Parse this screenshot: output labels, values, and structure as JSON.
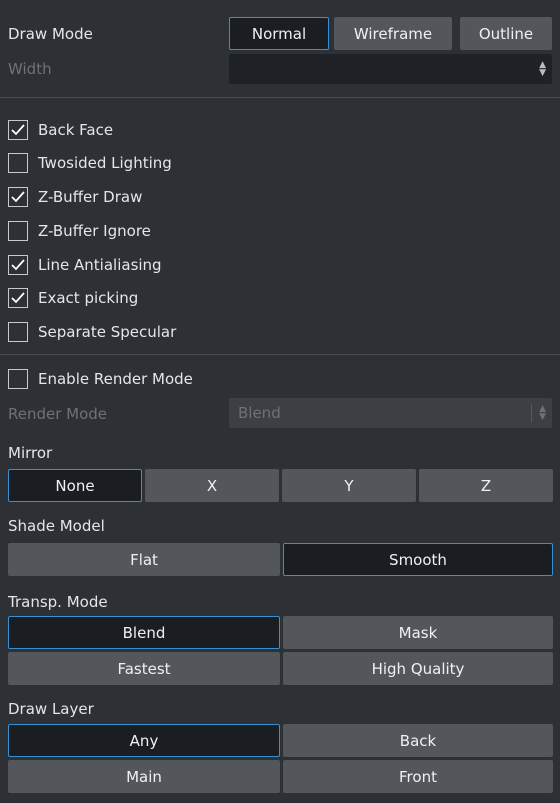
{
  "draw_mode": {
    "label": "Draw Mode",
    "options": [
      "Normal",
      "Wireframe",
      "Outline"
    ],
    "selected": "Normal"
  },
  "width": {
    "label": "Width",
    "value": ""
  },
  "checkboxes": [
    {
      "label": "Back Face",
      "checked": true
    },
    {
      "label": "Twosided Lighting",
      "checked": false
    },
    {
      "label": "Z-Buffer Draw",
      "checked": true
    },
    {
      "label": "Z-Buffer Ignore",
      "checked": false
    },
    {
      "label": "Line Antialiasing",
      "checked": true
    },
    {
      "label": "Exact picking",
      "checked": true
    },
    {
      "label": "Separate Specular",
      "checked": false
    }
  ],
  "enable_render_mode": {
    "label": "Enable Render Mode",
    "checked": false
  },
  "render_mode": {
    "label": "Render Mode",
    "value": "Blend"
  },
  "mirror": {
    "label": "Mirror",
    "options": [
      "None",
      "X",
      "Y",
      "Z"
    ],
    "selected": "None"
  },
  "shade_model": {
    "label": "Shade Model",
    "options": [
      "Flat",
      "Smooth"
    ],
    "selected": "Smooth"
  },
  "transp_mode": {
    "label": "Transp. Mode",
    "options": [
      "Blend",
      "Mask",
      "Fastest",
      "High Quality"
    ],
    "selected": "Blend"
  },
  "draw_layer": {
    "label": "Draw Layer",
    "options": [
      "Any",
      "Back",
      "Main",
      "Front"
    ],
    "selected": "Any"
  },
  "colors": {
    "accent": "#3a8fd0",
    "panel": "#2d3034",
    "button": "#53575b",
    "active_button": "#1a1d22"
  }
}
